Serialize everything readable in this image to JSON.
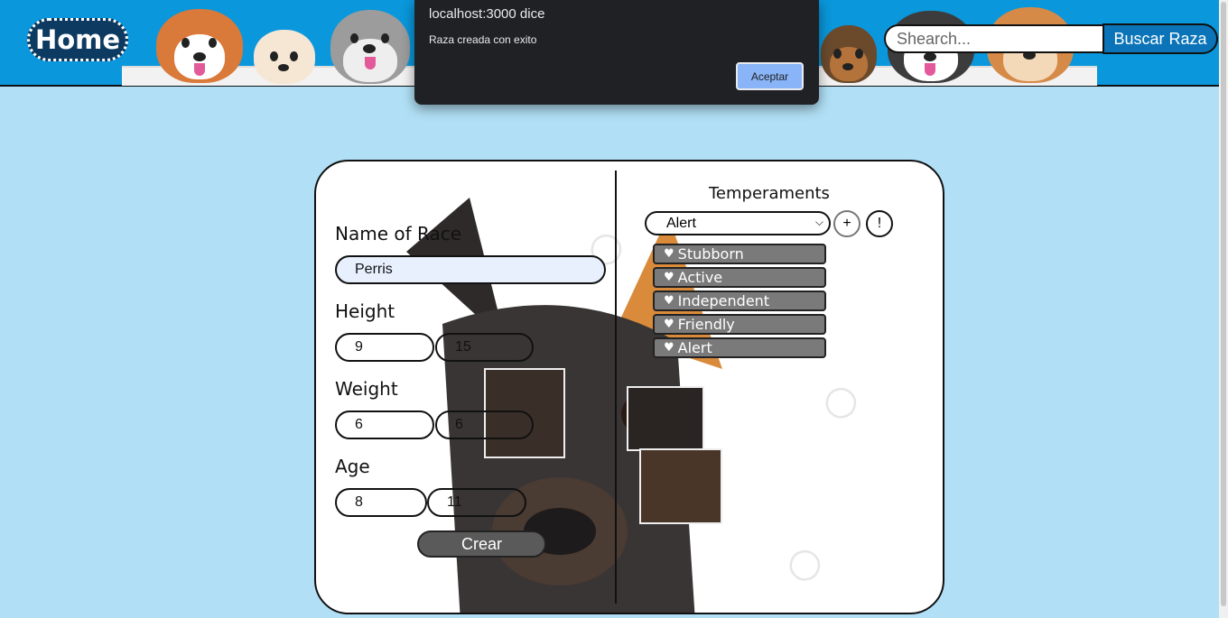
{
  "header": {
    "home_label": "Home",
    "search": {
      "placeholder": "Shearch...",
      "value": ""
    },
    "search_button_label": "Buscar Raza"
  },
  "form": {
    "name_label": "Name of Race",
    "name_value": "Perris",
    "height_label": "Height",
    "height_min": "9",
    "height_max": "15",
    "weight_label": "Weight",
    "weight_min": "6",
    "weight_max": "6",
    "age_label": "Age",
    "age_min": "8",
    "age_max": "11",
    "submit_label": "Crear"
  },
  "temperaments": {
    "title": "Temperaments",
    "selected": "Alert",
    "add_label": "+",
    "info_label": "!",
    "items": [
      "Stubborn",
      "Active",
      "Independent",
      "Friendly",
      "Alert"
    ]
  },
  "dialog": {
    "title": "localhost:3000 dice",
    "message": "Raza creada con exito",
    "ok_label": "Aceptar"
  },
  "colors": {
    "page_bg": "#b1e0f6",
    "header_bg": "#0a97db",
    "home_btn_bg": "#0d3a61",
    "dialog_bg": "#202124",
    "dialog_accent": "#8ab4f8",
    "temp_item_bg": "#7a7a7a"
  },
  "icons": [
    "heart-icon",
    "chevron-down-icon"
  ]
}
